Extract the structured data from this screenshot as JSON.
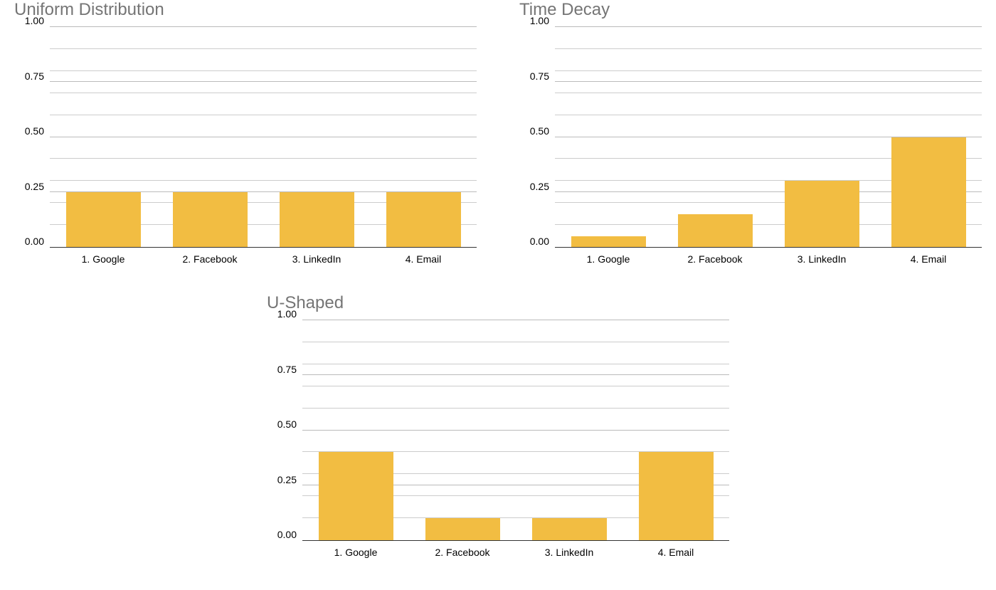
{
  "chart_data": [
    {
      "type": "bar",
      "title": "Uniform Distribution",
      "categories": [
        "1. Google",
        "2. Facebook",
        "3. LinkedIn",
        "4. Email"
      ],
      "values": [
        0.25,
        0.25,
        0.25,
        0.25
      ],
      "ylim": [
        0.0,
        1.0
      ],
      "yticks": [
        0.0,
        0.25,
        0.5,
        0.75,
        1.0
      ],
      "ytick_labels": [
        "0.00",
        "0.25",
        "0.50",
        "0.75",
        "1.00"
      ],
      "bar_color": "#f2bd42",
      "grid": true
    },
    {
      "type": "bar",
      "title": "Time Decay",
      "categories": [
        "1. Google",
        "2. Facebook",
        "3. LinkedIn",
        "4. Email"
      ],
      "values": [
        0.05,
        0.15,
        0.3,
        0.5
      ],
      "ylim": [
        0.0,
        1.0
      ],
      "yticks": [
        0.0,
        0.25,
        0.5,
        0.75,
        1.0
      ],
      "ytick_labels": [
        "0.00",
        "0.25",
        "0.50",
        "0.75",
        "1.00"
      ],
      "bar_color": "#f2bd42",
      "grid": true
    },
    {
      "type": "bar",
      "title": "U-Shaped",
      "categories": [
        "1. Google",
        "2. Facebook",
        "3. LinkedIn",
        "4. Email"
      ],
      "values": [
        0.4,
        0.1,
        0.1,
        0.4
      ],
      "ylim": [
        0.0,
        1.0
      ],
      "yticks": [
        0.0,
        0.25,
        0.5,
        0.75,
        1.0
      ],
      "ytick_labels": [
        "0.00",
        "0.25",
        "0.50",
        "0.75",
        "1.00"
      ],
      "bar_color": "#f2bd42",
      "grid": true
    }
  ]
}
